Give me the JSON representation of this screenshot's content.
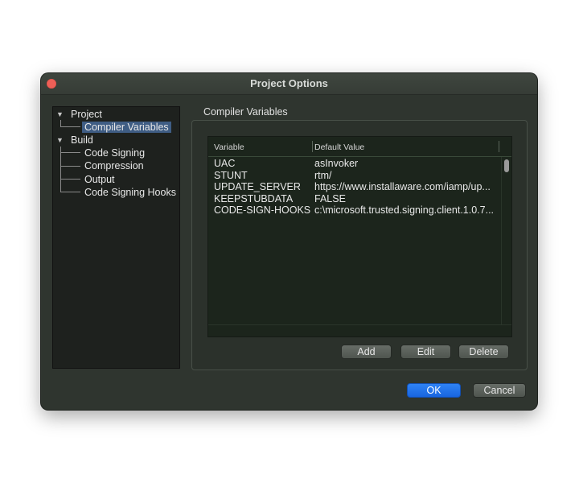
{
  "window": {
    "title": "Project Options"
  },
  "tree": {
    "project": {
      "label": "Project",
      "children": [
        "Compiler Variables"
      ]
    },
    "build": {
      "label": "Build",
      "children": [
        "Code Signing",
        "Compression",
        "Output",
        "Code Signing Hooks"
      ]
    }
  },
  "section_title": "Compiler Variables",
  "table": {
    "columns": [
      "Variable",
      "Default Value"
    ],
    "rows": [
      {
        "variable": "UAC",
        "value": "asInvoker"
      },
      {
        "variable": "STUNT",
        "value": "rtm/"
      },
      {
        "variable": "UPDATE_SERVER",
        "value": "https://www.installaware.com/iamp/up..."
      },
      {
        "variable": "KEEPSTUBDATA",
        "value": "FALSE"
      },
      {
        "variable": "CODE-SIGN-HOOKS",
        "value": "c:\\microsoft.trusted.signing.client.1.0.7..."
      }
    ]
  },
  "buttons": {
    "add": "Add",
    "edit": "Edit",
    "delete": "Delete",
    "ok": "OK",
    "cancel": "Cancel"
  },
  "colors": {
    "window_bg": "#2f352f",
    "selection": "#3f5d84",
    "ok_button": "#1865e0",
    "close_button": "#ed5f57"
  }
}
